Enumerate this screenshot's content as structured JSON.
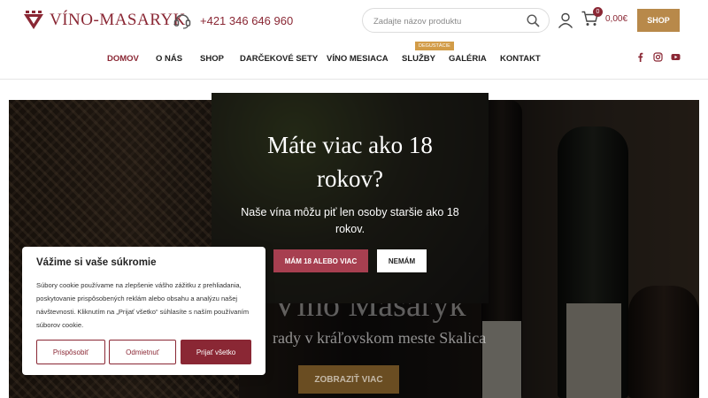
{
  "brand": {
    "name": "VÍNO-MASARYK",
    "color": "#8a2734",
    "gold": "#b8894a"
  },
  "header": {
    "phone": "+421 346 646 960",
    "search_placeholder": "Zadajte názov produktu",
    "cart_count": "0",
    "cart_total": "0,00€",
    "shop_label": "SHOP"
  },
  "nav": {
    "items": [
      {
        "label": "DOMOV"
      },
      {
        "label": "O NÁS"
      },
      {
        "label": "SHOP"
      },
      {
        "label": "DARČEKOVÉ SETY"
      },
      {
        "label": "VÍNO MESIACA"
      },
      {
        "label": "SLUŽBY"
      },
      {
        "label": "GALÉRIA"
      },
      {
        "label": "KONTAKT"
      }
    ],
    "badge": "DEGUSTÁCIE",
    "socials": [
      "facebook-icon",
      "instagram-icon",
      "youtube-icon"
    ]
  },
  "hero": {
    "title": "Víno Masaryk",
    "subtitle": "rady v kráľovskom meste Skalica",
    "button": "ZOBRAZIŤ VIAC"
  },
  "age_modal": {
    "title": "Máte viac ako 18 rokov?",
    "text": "Naše vína môžu piť len osoby staršie ako 18 rokov.",
    "yes_label": "MÁM 18 ALEBO VIAC",
    "no_label": "NEMÁM"
  },
  "cookie": {
    "title": "Vážime si vaše súkromie",
    "text": "Súbory cookie používame na zlepšenie vášho zážitku z prehliadania, poskytovanie prispôsobených reklám alebo obsahu a analýzu našej návštevnosti. Kliknutím na „Prijať všetko“ súhlasíte s naším používaním súborov cookie.",
    "customize_label": "Prispôsobiť",
    "reject_label": "Odmietnuť",
    "accept_label": "Prijať všetko"
  }
}
